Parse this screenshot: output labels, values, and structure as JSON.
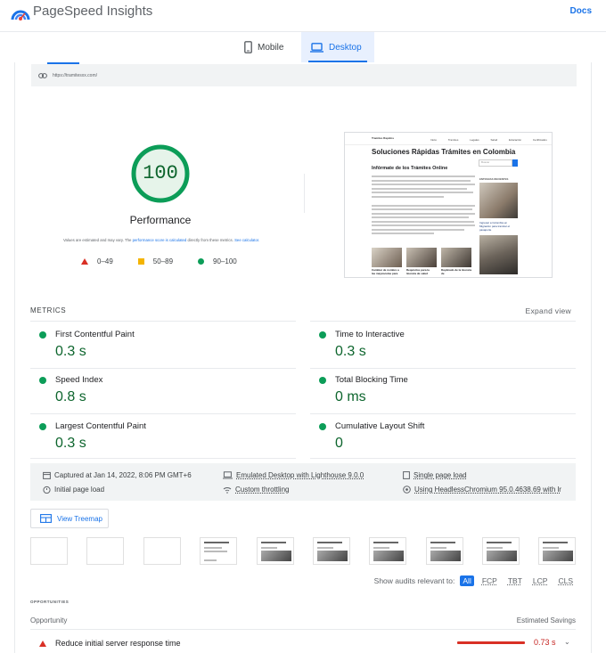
{
  "header": {
    "title": "PageSpeed Insights",
    "docs_label": "Docs"
  },
  "tabs": [
    {
      "label": "Mobile"
    },
    {
      "label": "Desktop",
      "selected": true
    }
  ],
  "url": "https://tramitesxx.com/",
  "score": {
    "value": "100",
    "label": "Performance",
    "disclaimer_prefix": "Values are estimated and may vary. The",
    "disclaimer_link": "performance score is calculated",
    "disclaimer_mid": "directly from these metrics.",
    "disclaimer_link2": "See calculator."
  },
  "legend": [
    {
      "range": "0–49",
      "color": "#d93025"
    },
    {
      "range": "50–89",
      "color": "#f4b400"
    },
    {
      "range": "90–100",
      "color": "#0c9d58"
    }
  ],
  "preview": {
    "brand": "Tramites Rapidos",
    "nav": "Inicio Tramites Legales Salud Educación Certificados",
    "heading": "Soluciones Rápidas Trámites en Colombia",
    "subheading": "Infórmate de los Trámites Online",
    "search_placeholder": "Buscar",
    "side_title": "ENTRADAS RECIENTES",
    "side_caption": "Ingresar a Colombia en Migración para tramitar el pasaporte",
    "cards": [
      "Cambiar de nombre a las mayúsculas para",
      "Requisitos para la licencia de salud",
      "Duplicado de la licencia de"
    ]
  },
  "metrics": {
    "title": "METRICS",
    "expand_label": "Expand view",
    "items": [
      {
        "label": "First Contentful Paint",
        "value": "0.3 s"
      },
      {
        "label": "Time to Interactive",
        "value": "0.3 s"
      },
      {
        "label": "Speed Index",
        "value": "0.8 s"
      },
      {
        "label": "Total Blocking Time",
        "value": "0 ms"
      },
      {
        "label": "Largest Contentful Paint",
        "value": "0.3 s"
      },
      {
        "label": "Cumulative Layout Shift",
        "value": "0"
      }
    ]
  },
  "info": {
    "captured": "Captured at Jan 14, 2022, 8:06 PM GMT+6",
    "emulated": "Emulated Desktop with Lighthouse 9.0.0",
    "single_page": "Single page load",
    "initial_load": "Initial page load",
    "throttling": "Custom throttling",
    "browser": "Using HeadlessChromium 95.0.4638.69 with lr"
  },
  "treemap_label": "View Treemap",
  "audits": {
    "label": "Show audits relevant to:",
    "chips": [
      "All",
      "FCP",
      "TBT",
      "LCP",
      "CLS"
    ]
  },
  "opportunities": {
    "title": "OPPORTUNITIES",
    "col_opportunity": "Opportunity",
    "col_savings": "Estimated Savings",
    "items": [
      {
        "label": "Reduce initial server response time",
        "savings": "0.73 s"
      }
    ]
  }
}
